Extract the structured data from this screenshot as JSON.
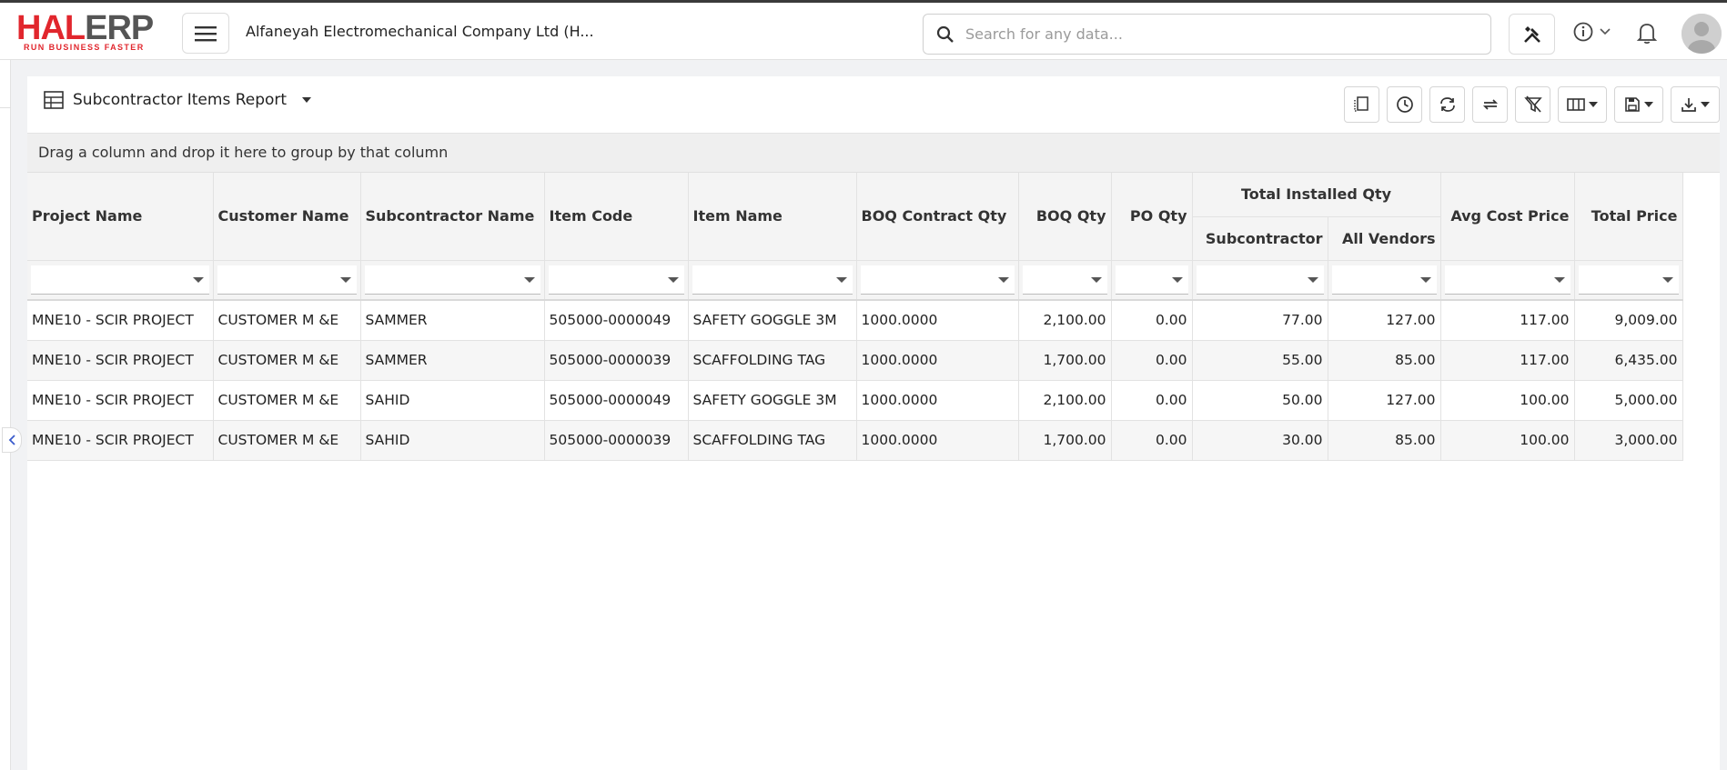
{
  "app": {
    "logo_hal": "HAL",
    "logo_erp": "ERP",
    "logo_tagline": "RUN BUSINESS FASTER",
    "company": "Alfaneyah Electromechanical Company Ltd (H...",
    "search_placeholder": "Search for any data..."
  },
  "report": {
    "title": "Subcontractor Items Report",
    "group_hint": "Drag a column and drop it here to group by that column",
    "toolbar_icons": [
      "page-layout-icon",
      "history-icon",
      "refresh-icon",
      "swap-icon",
      "clear-filter-icon",
      "columns-icon",
      "save-icon",
      "download-icon"
    ]
  },
  "grid": {
    "headers": {
      "project_name": "Project Name",
      "customer_name": "Customer Name",
      "subcontractor_name": "Subcontractor Name",
      "item_code": "Item Code",
      "item_name": "Item Name",
      "boq_contract_qty": "BOQ Contract Qty",
      "boq_qty": "BOQ Qty",
      "po_qty": "PO Qty",
      "total_installed_qty": "Total Installed Qty",
      "subcontractor": "Subcontractor",
      "all_vendors": "All Vendors",
      "avg_cost_price": "Avg Cost Price",
      "total_price": "Total Price"
    },
    "rows": [
      {
        "project": "MNE10 - SCIR PROJECT",
        "customer": "CUSTOMER M &E",
        "subcontractor": "SAMMER",
        "item_code": "505000-0000049",
        "item_name": "SAFETY GOGGLE 3M",
        "boq_contract_qty": "1000.0000",
        "boq_qty": "2,100.00",
        "po_qty": "0.00",
        "inst_sub": "77.00",
        "inst_all": "127.00",
        "avg_cost": "117.00",
        "total_price": "9,009.00"
      },
      {
        "project": "MNE10 - SCIR PROJECT",
        "customer": "CUSTOMER M &E",
        "subcontractor": "SAMMER",
        "item_code": "505000-0000039",
        "item_name": "SCAFFOLDING TAG",
        "boq_contract_qty": "1000.0000",
        "boq_qty": "1,700.00",
        "po_qty": "0.00",
        "inst_sub": "55.00",
        "inst_all": "85.00",
        "avg_cost": "117.00",
        "total_price": "6,435.00"
      },
      {
        "project": "MNE10 - SCIR PROJECT",
        "customer": "CUSTOMER M &E",
        "subcontractor": "SAHID",
        "item_code": "505000-0000049",
        "item_name": "SAFETY GOGGLE 3M",
        "boq_contract_qty": "1000.0000",
        "boq_qty": "2,100.00",
        "po_qty": "0.00",
        "inst_sub": "50.00",
        "inst_all": "127.00",
        "avg_cost": "100.00",
        "total_price": "5,000.00"
      },
      {
        "project": "MNE10 - SCIR PROJECT",
        "customer": "CUSTOMER M &E",
        "subcontractor": "SAHID",
        "item_code": "505000-0000039",
        "item_name": "SCAFFOLDING TAG",
        "boq_contract_qty": "1000.0000",
        "boq_qty": "1,700.00",
        "po_qty": "0.00",
        "inst_sub": "30.00",
        "inst_all": "85.00",
        "avg_cost": "100.00",
        "total_price": "3,000.00"
      }
    ]
  },
  "colors": {
    "brand_red": "#e1262d",
    "brand_gray": "#555555",
    "accent_blue": "#3b5ccc"
  }
}
